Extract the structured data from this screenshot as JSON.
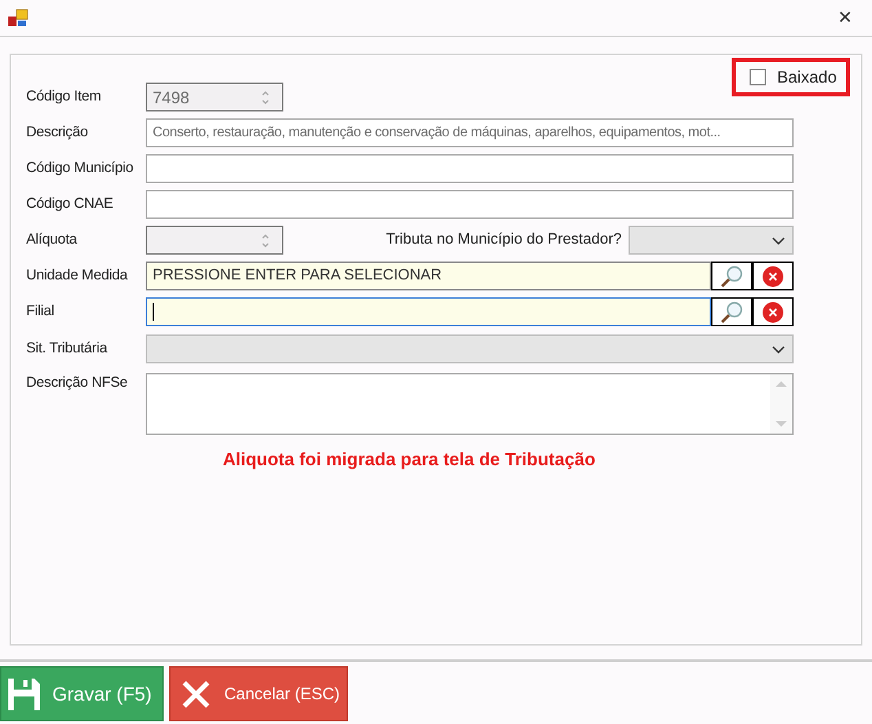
{
  "window": {
    "close": "✕"
  },
  "baixado": {
    "label": "Baixado",
    "checked": false
  },
  "fields": [
    {
      "kind": "spinner",
      "label": "Código Item",
      "value": "7498",
      "disabled": true
    },
    {
      "kind": "text",
      "label": "Descrição",
      "value": "Conserto, restauração, manutenção e conservação de máquinas, aparelhos, equipamentos, mot...",
      "disabled": true
    },
    {
      "kind": "text",
      "label": "Código Município"
    },
    {
      "kind": "text",
      "label": "Código CNAE"
    },
    {
      "kind": "spinner_select",
      "label": "Alíquota",
      "disabled": true,
      "select_label": "Tributa no Município do Prestador?"
    },
    {
      "kind": "lookup",
      "label": "Unidade Medida",
      "value": "PRESSIONE ENTER PARA SELECIONAR",
      "focused": false
    },
    {
      "kind": "lookup",
      "label": "Filial",
      "focused": true
    },
    {
      "kind": "select",
      "label": "Sit. Tributária",
      "disabled": true
    },
    {
      "kind": "textarea",
      "label": "Descrição NFSe"
    }
  ],
  "message": "Aliquota foi migrada para tela de Tributação",
  "buttons": [
    {
      "kind": "save",
      "label": "Gravar (F5)"
    },
    {
      "kind": "cancel",
      "label": "Cancelar (ESC)"
    }
  ]
}
